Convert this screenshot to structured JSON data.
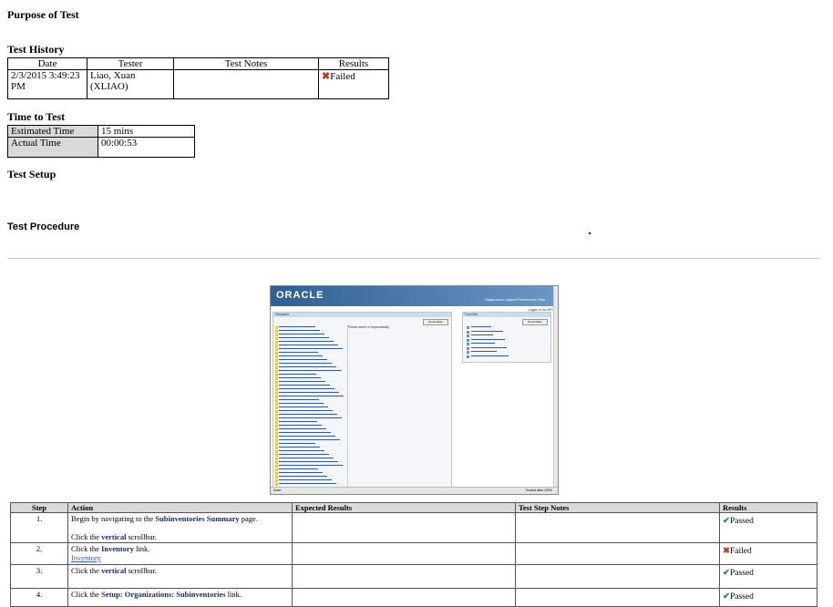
{
  "purpose": {
    "heading": "Purpose of Test"
  },
  "history": {
    "heading": "Test History",
    "columns": [
      "Date",
      "Tester",
      "Test Notes",
      "Results"
    ],
    "row": {
      "date": "2/3/2015 3:49:23 PM",
      "tester": "Liao, Xuan (XLIAO)",
      "notes": "",
      "result": "Failed"
    }
  },
  "time": {
    "heading": "Time to Test",
    "estimated_label": "Estimated Time",
    "estimated_value": "15 mins",
    "actual_label": "Actual Time",
    "actual_value": "00:00:53"
  },
  "setup": {
    "heading": "Test Setup"
  },
  "procedure": {
    "heading": "Test Procedure"
  },
  "screenshot": {
    "logo": "ORACLE",
    "header_links": "Diagnostics  Logout  Preferences  Help",
    "logged_in": "Logged In As MFG",
    "navigator_title": "Navigator",
    "favorites_title": "Favorites",
    "personalize": "Personalize",
    "select_resp": "Please select a responsibility.",
    "status_left": "Done",
    "status_right": "Trusted sites    100%"
  },
  "steps": {
    "columns": [
      "Step",
      "Action",
      "Expected Results",
      "Test Step Notes",
      "Results"
    ],
    "rows": [
      {
        "num": "1.",
        "a1": "Begin by navigating to the ",
        "a1b": "Subinventories Summary",
        "a1c": " page.",
        "a2": "Click the ",
        "a2b": "vertical",
        "a2c": " scrollbar.",
        "result": "Passed"
      },
      {
        "num": "2.",
        "a1": "Click the ",
        "a1b": "Inventory",
        "a1c": " link.",
        "link": "Inventory",
        "result": "Failed"
      },
      {
        "num": "3.",
        "a1": "Click the ",
        "a1b": "vertical",
        "a1c": " scrollbar.",
        "result": "Passed"
      },
      {
        "num": "4.",
        "a1": "Click the ",
        "a1b": "Setup: Organizations: Subinventories",
        "a1c": " link.",
        "result": "Passed"
      }
    ]
  }
}
